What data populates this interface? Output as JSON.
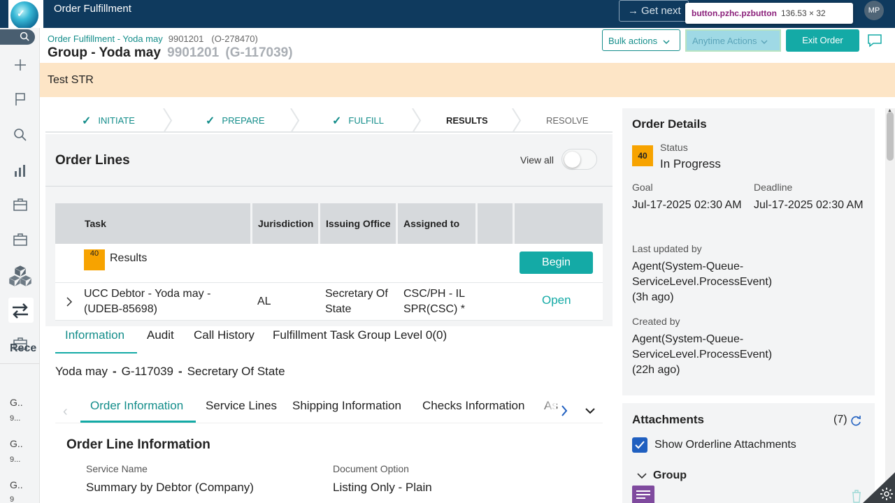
{
  "app": {
    "title": "Order Fulfillment",
    "user_initials": "MP",
    "get_next_label": "Get next"
  },
  "tooltip": {
    "selector": "button.pzhc.pzbutton",
    "dims": "136.53 × 32"
  },
  "header": {
    "breadcrumb_link": "Order Fulfillment - Yoda may",
    "breadcrumb_id": "9901201",
    "breadcrumb_order": "(O-278470)",
    "title": "Group - Yoda may",
    "title_id": "9901201",
    "title_group": "(G-117039)",
    "bulk_actions": "Bulk actions",
    "anytime_actions": "Anytime Actions",
    "exit_order": "Exit Order"
  },
  "banner": "Test STR",
  "stages": [
    {
      "label": "INITIATE",
      "state": "done"
    },
    {
      "label": "PREPARE",
      "state": "done"
    },
    {
      "label": "FULFILL",
      "state": "done"
    },
    {
      "label": "RESULTS",
      "state": "current"
    },
    {
      "label": "RESOLVE",
      "state": "pending"
    }
  ],
  "order_lines": {
    "title": "Order Lines",
    "view_all": "View all",
    "view_all_on": false,
    "columns": [
      "Task",
      "Jurisdiction",
      "Issuing Office",
      "Assigned to",
      "",
      ""
    ],
    "results_row": {
      "badge": "40",
      "label": "Results",
      "action": "Begin"
    },
    "rows": [
      {
        "task_line1": "UCC Debtor - Yoda may -",
        "task_line2": "(UDEB-85698)",
        "jurisdiction": "AL",
        "office_line1": "Secretary Of",
        "office_line2": "State",
        "assigned_line1": "CSC/PH - IL",
        "assigned_line2": "SPR(CSC) *",
        "action": "Open"
      }
    ]
  },
  "tabs": [
    {
      "label": "Information",
      "active": true
    },
    {
      "label": "Audit",
      "active": false
    },
    {
      "label": "Call History",
      "active": false
    },
    {
      "label": "Fulfillment Task Group Level 0(0)",
      "active": false
    }
  ],
  "info": {
    "name": "Yoda may",
    "group": "G-117039",
    "office": "Secretary Of State"
  },
  "subtabs": [
    {
      "label": "Order Information",
      "active": true
    },
    {
      "label": "Service Lines",
      "active": false
    },
    {
      "label": "Shipping Information",
      "active": false
    },
    {
      "label": "Checks Information",
      "active": false
    },
    {
      "label": "As",
      "active": false
    }
  ],
  "order_line_info": {
    "title": "Order Line Information",
    "service_name_label": "Service Name",
    "service_name_value": "Summary by Debtor (Company)",
    "doc_option_label": "Document Option",
    "doc_option_value": "Listing Only - Plain"
  },
  "order_details": {
    "title": "Order Details",
    "badge": "40",
    "status_label": "Status",
    "status_value": "In Progress",
    "goal_label": "Goal",
    "goal_value": "Jul-17-2025 02:30 AM",
    "deadline_label": "Deadline",
    "deadline_value": "Jul-17-2025 02:30 AM",
    "updated_label": "Last updated by",
    "updated_line1": "Agent(System-Queue-",
    "updated_line2": "ServiceLevel.ProcessEvent)",
    "updated_line3": "(3h ago)",
    "created_label": "Created by",
    "created_line1": "Agent(System-Queue-",
    "created_line2": "ServiceLevel.ProcessEvent)",
    "created_line3": "(22h ago)"
  },
  "attachments": {
    "title": "Attachments",
    "count": "(7)",
    "show_orderline_label": "Show Orderline Attachments",
    "show_orderline_checked": true,
    "group_label": "Group"
  },
  "recent": {
    "title": "Rece",
    "items": [
      {
        "line1": "G..",
        "line2": "9..."
      },
      {
        "line1": "G..",
        "line2": "9..."
      },
      {
        "line1": "G..",
        "line2": "9"
      }
    ]
  },
  "colors": {
    "topbar": "#0f3a5e",
    "accent": "#14aaa6",
    "banner": "#fde5c6",
    "badge": "#f7a300"
  }
}
